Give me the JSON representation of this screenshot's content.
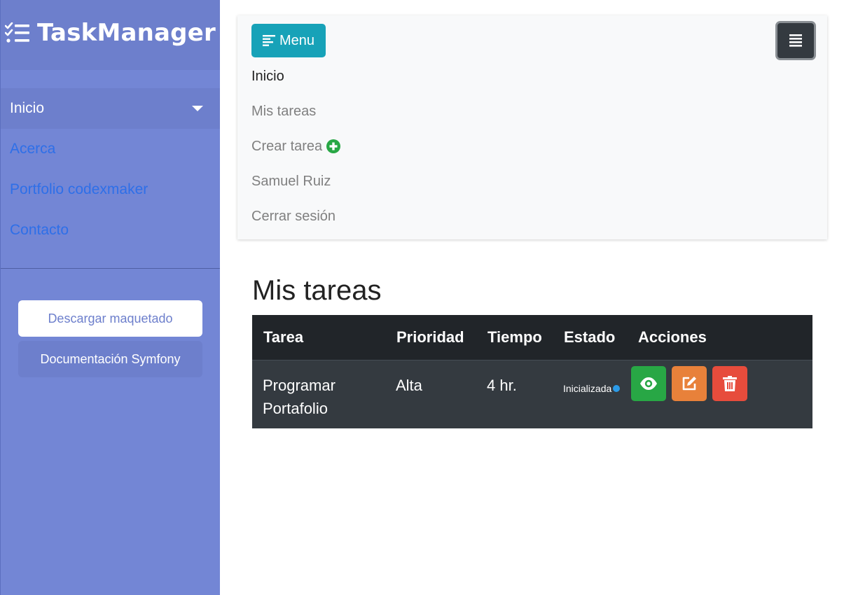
{
  "brand": {
    "title": "TaskManager",
    "icon": "tasks-list-icon"
  },
  "sidebar": {
    "items": [
      {
        "label": "Inicio",
        "active": true
      },
      {
        "label": "Acerca"
      },
      {
        "label": "Portfolio codexmaker"
      },
      {
        "label": "Contacto"
      }
    ],
    "download_label": "Descargar maquetado",
    "docs_label": "Documentación Symfony"
  },
  "topnav": {
    "menu_label": "Menu",
    "links": [
      {
        "label": "Inicio",
        "active": true
      },
      {
        "label": "Mis tareas"
      },
      {
        "label": "Crear tarea",
        "icon": "plus-circle-icon"
      },
      {
        "label": "Samuel Ruiz"
      },
      {
        "label": "Cerrar sesión"
      }
    ]
  },
  "main": {
    "title": "Mis tareas",
    "table": {
      "headers": [
        "Tarea",
        "Prioridad",
        "Tiempo",
        "Estado",
        "Acciones"
      ],
      "rows": [
        {
          "task": "Programar Portafolio",
          "priority": "Alta",
          "time": "4 hr.",
          "status": "Inicializada",
          "actions": [
            "eye-icon",
            "edit-icon",
            "trash-icon"
          ]
        }
      ]
    }
  },
  "colors": {
    "sidebar_bg": "#7386D5",
    "sidebar_active": "#6d7fcc",
    "link": "#2e6fe8",
    "menu_button": "#17a2b8",
    "view": "#28a745",
    "edit": "#e8813a",
    "delete": "#e74c3c",
    "status_dot": "#2b9be8",
    "table_head": "#212529",
    "table_row": "#343a40"
  }
}
